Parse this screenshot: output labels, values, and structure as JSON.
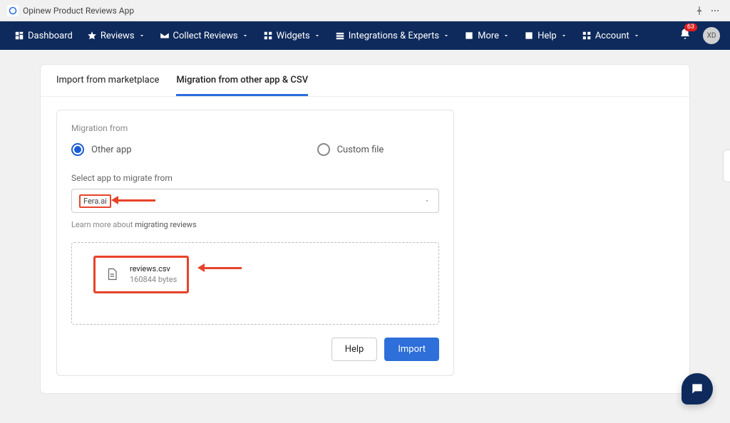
{
  "titlebar": {
    "app_name": "Opinew Product Reviews App"
  },
  "nav": {
    "dashboard": "Dashboard",
    "reviews": "Reviews",
    "collect": "Collect Reviews",
    "widgets": "Widgets",
    "integrations": "Integrations & Experts",
    "more": "More",
    "help": "Help",
    "account": "Account",
    "badge_count": "63",
    "avatar_initials": "XD"
  },
  "tabs": {
    "marketplace": "Import from marketplace",
    "migration": "Migration from other app & CSV"
  },
  "migration": {
    "heading": "Migration from",
    "opt_other": "Other app",
    "opt_custom": "Custom file",
    "select_label": "Select app to migrate from",
    "select_value": "Fera.ai",
    "learn_prefix": "Learn more about ",
    "learn_link": "migrating reviews",
    "file": {
      "name": "reviews.csv",
      "size": "160844 bytes"
    }
  },
  "actions": {
    "help": "Help",
    "import": "Import"
  }
}
